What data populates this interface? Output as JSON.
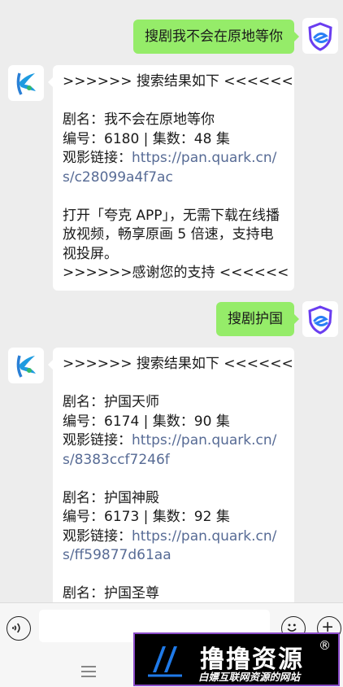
{
  "messages": [
    {
      "text": "搜剧我不会在原地等你"
    },
    {
      "lines": [
        ">>>>>> 搜索结果如下 <<<<<<",
        "",
        "剧名：我不会在原地等你",
        "编号：6180 | 集数：48 集"
      ],
      "link_label": "观影链接：",
      "link_url": "https://pan.quark.cn/s/c28099a4f7ac",
      "note": "打开「夸克 APP」，无需下载在线播放视频，畅享原画 5 倍速，支持电视投屏。",
      "footer": ">>>>>>感谢您的支持 <<<<<<"
    },
    {
      "text": "搜剧护国"
    },
    {
      "header": ">>>>>> 搜索结果如下 <<<<<<",
      "results": [
        {
          "name": "剧名：护国天师",
          "info": "编号：6174 | 集数：90 集",
          "link_label": "观影链接：",
          "link_url": "https://pan.quark.cn/s/8383ccf7246f"
        },
        {
          "name": "剧名：护国神殿",
          "info": "编号：6173 | 集数：92 集",
          "link_label": "观影链接：",
          "link_url": "https://pan.quark.cn/s/ff59877d61aa"
        },
        {
          "name": "剧名：护国圣尊"
        }
      ]
    }
  ],
  "watermark": {
    "title": "撸撸资源",
    "reg": "®",
    "subtitle": "白嫖互联网资源的网站"
  },
  "icons": {
    "bot_avatar": "blue-swirl-logo-icon",
    "user_avatar": "purple-shield-e-icon",
    "voice": "voice-icon",
    "emoji": "emoji-icon",
    "plus": "plus-icon",
    "menu": "menu-lines-icon"
  },
  "colors": {
    "background": "#ededed",
    "out_bubble": "#95ec69",
    "in_bubble": "#ffffff",
    "link": "#576b95",
    "watermark_border": "#8a4bc8"
  }
}
